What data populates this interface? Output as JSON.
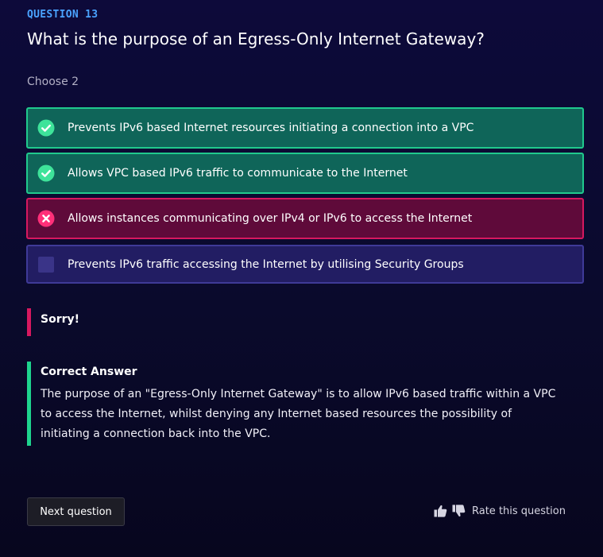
{
  "question": {
    "number_label": "QUESTION 13",
    "text": "What is the purpose of an Egress-Only Internet Gateway?",
    "instruction": "Choose 2"
  },
  "options": [
    {
      "label": "Prevents IPv6 based Internet resources initiating a connection into a VPC",
      "state": "correct",
      "icon": "check-circle-icon"
    },
    {
      "label": "Allows VPC based IPv6 traffic to communicate to the Internet",
      "state": "correct",
      "icon": "check-circle-icon"
    },
    {
      "label": "Allows instances communicating over IPv4 or IPv6 to access the Internet",
      "state": "wrong",
      "icon": "x-circle-icon"
    },
    {
      "label": "Prevents IPv6 traffic accessing the Internet by utilising Security Groups",
      "state": "unselected",
      "icon": "checkbox-icon"
    }
  ],
  "feedback": {
    "result": "Sorry!",
    "correct_title": "Correct Answer",
    "correct_body": "The purpose of an \"Egress-Only Internet Gateway\" is to allow IPv6 based traffic within a VPC to access the Internet, whilst denying any Internet based resources the possibility of initiating a connection back into the VPC."
  },
  "footer": {
    "next_label": "Next question",
    "rate_label": "Rate this question",
    "thumb_icons": [
      "thumbs-up-icon",
      "thumbs-down-icon"
    ]
  },
  "colors": {
    "accent_blue": "#4aa3ff",
    "correct_green": "#20c98d",
    "wrong_red": "#d6185f",
    "neutral_purple": "#3f3a98",
    "background": "#0d0a3a"
  }
}
